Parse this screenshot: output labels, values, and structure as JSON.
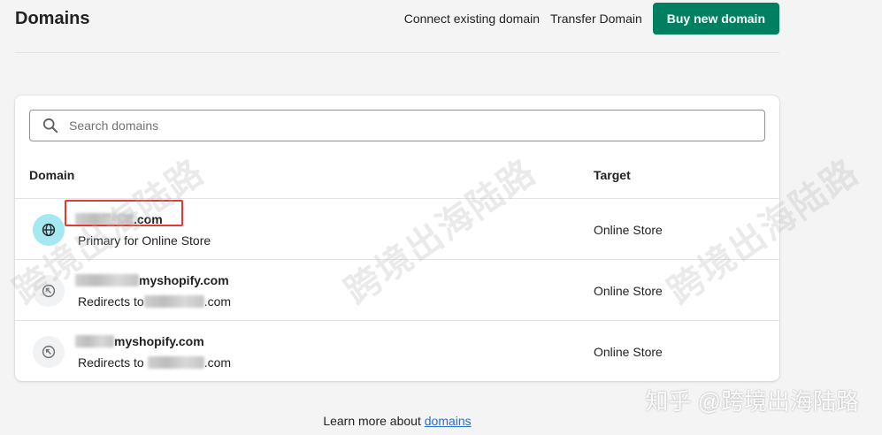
{
  "header": {
    "title": "Domains",
    "connect_label": "Connect existing domain",
    "transfer_label": "Transfer Domain",
    "buy_label": "Buy new domain"
  },
  "search": {
    "placeholder": "Search domains"
  },
  "table": {
    "col_domain": "Domain",
    "col_target": "Target",
    "rows": [
      {
        "domain_suffix": ".com",
        "subtitle": "Primary for Online Store",
        "target": "Online Store",
        "icon": "globe-icon"
      },
      {
        "domain_suffix": "myshopify.com",
        "subtitle_prefix": "Redirects to",
        "subtitle_suffix": ".com",
        "target": "Online Store",
        "icon": "redirect-arrow-icon"
      },
      {
        "domain_suffix": "myshopify.com",
        "subtitle_prefix": "Redirects to",
        "subtitle_suffix": ".com",
        "target": "Online Store",
        "icon": "redirect-arrow-icon"
      }
    ]
  },
  "footer": {
    "text": "Learn more about",
    "link": "domains"
  },
  "watermark": {
    "text": "跨境出海陆路",
    "corner": "知乎 @跨境出海陆路"
  },
  "colors": {
    "primary": "#008060",
    "highlight": "#e03a32",
    "link": "#2c6ecb"
  }
}
